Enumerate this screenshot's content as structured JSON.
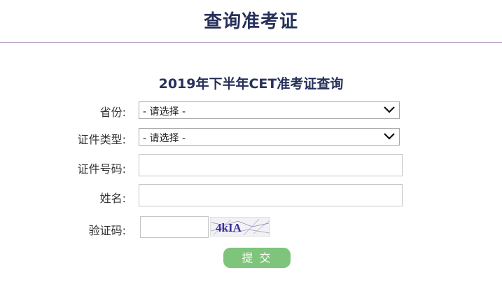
{
  "page": {
    "title": "查询准考证"
  },
  "form": {
    "title": "2019年下半年CET准考证查询",
    "province": {
      "label": "省份:",
      "selected": "- 请选择 -"
    },
    "cert_type": {
      "label": "证件类型:",
      "selected": "- 请选择 -"
    },
    "id_number": {
      "label": "证件号码:",
      "value": ""
    },
    "name": {
      "label": "姓名:",
      "value": ""
    },
    "captcha": {
      "label": "验证码:",
      "value": "",
      "image_text": "4kIA"
    },
    "submit_label": "提  交"
  },
  "colors": {
    "title": "#26305a",
    "header_border": "#b89ac8",
    "submit_bg": "#7ec47a",
    "captcha_text": "#3a2f9e"
  },
  "icons": {
    "select_arrow": "chevron-down-icon"
  }
}
